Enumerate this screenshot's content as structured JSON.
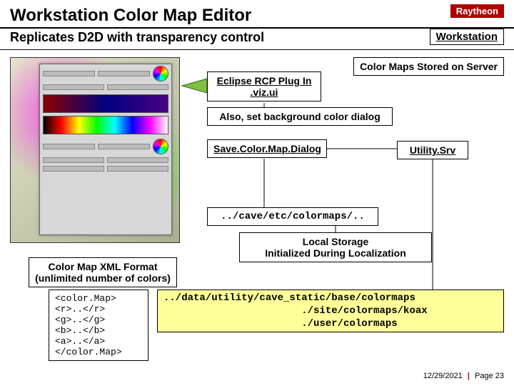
{
  "brand": "Raytheon",
  "title": "Workstation Color Map Editor",
  "subtitle": "Replicates D2D with transparency control",
  "workstation_label": "Workstation",
  "server_label": "Color Maps Stored on Server",
  "eclipse_plugin": {
    "line1": "Eclipse RCP Plug In",
    "line2": ".viz.ui"
  },
  "also_label": "Also, set background color dialog",
  "save_dialog": "Save.Color.Map.Dialog",
  "utility_srv": "Utility.Srv",
  "cave_path": "../cave/etc/colormaps/..",
  "local_storage": {
    "line1": "Local Storage",
    "line2": "Initialized During Localization"
  },
  "xml_format": {
    "line1": "Color Map XML Format",
    "line2": "(unlimited number of colors)"
  },
  "xml_code": [
    "<color.Map>",
    "  <r>..</r>",
    "  <g>..</g>",
    "  <b>..</b>",
    "  <a>..</a>",
    "</color.Map>"
  ],
  "data_paths": [
    "../data/utility/cave_static/base/colormaps",
    "                       ./site/colormaps/koax",
    "                       ./user/colormaps"
  ],
  "footer": {
    "date": "12/29/2021",
    "page": "Page 23"
  }
}
